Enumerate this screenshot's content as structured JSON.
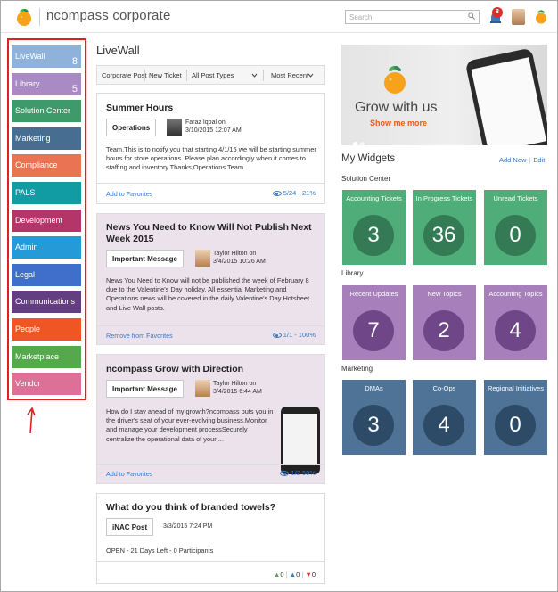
{
  "header": {
    "brand": "ncompass corporate",
    "search_placeholder": "Search",
    "notification_count": "8"
  },
  "sidebar": {
    "items": [
      {
        "label": "LiveWall",
        "count": "8",
        "color": "#8fb2db"
      },
      {
        "label": "Library",
        "count": "5",
        "color": "#a98ac5"
      },
      {
        "label": "Solution Center",
        "count": "",
        "color": "#3f9a6b"
      },
      {
        "label": "Marketing",
        "count": "",
        "color": "#476d90"
      },
      {
        "label": "Compliance",
        "count": "",
        "color": "#ea7353"
      },
      {
        "label": "PALS",
        "count": "",
        "color": "#119ba3"
      },
      {
        "label": "Development",
        "count": "",
        "color": "#b3356a"
      },
      {
        "label": "Admin",
        "count": "",
        "color": "#259ad8"
      },
      {
        "label": "Legal",
        "count": "",
        "color": "#3f6fcb"
      },
      {
        "label": "Communications",
        "count": "",
        "color": "#633f82"
      },
      {
        "label": "People",
        "count": "",
        "color": "#f05623"
      },
      {
        "label": "Marketplace",
        "count": "",
        "color": "#55a84b"
      },
      {
        "label": "Vendor",
        "count": "",
        "color": "#dd7096"
      }
    ]
  },
  "livewall": {
    "title": "LiveWall",
    "filters": {
      "corporate_post": "Corporate Post",
      "new_ticket": "New Ticket",
      "post_types": "All Post Types",
      "sort": "Most Recent"
    },
    "posts": [
      {
        "title": "Summer Hours",
        "tag": "Operations",
        "author": "Faraz Iqbal on",
        "date": "3/10/2015 12:07 AM",
        "body": "Team,This is to notify you that starting 4/1/15 we will be starting summer hours for store operations. Please plan accordingly when it comes to staffing and inventory.Thanks,Operations Team",
        "fav_label": "Add to Favorites",
        "views": "5/24 - 21%"
      },
      {
        "title": "News You Need to Know Will Not Publish Next Week 2015",
        "tag": "Important Message",
        "author": "Taylor Hilton on",
        "date": "3/4/2015 10:26 AM",
        "body": "News You Need to Know will not be published the week of February 8 due to the Valentine's Day holiday. All essential Marketing and Operations news will be covered in the daily Valentine's Day Hotsheet and Live Wall posts.",
        "fav_label": "Remove from Favorites",
        "views": "1/1 - 100%"
      },
      {
        "title": "ncompass Grow with Direction",
        "tag": "Important Message",
        "author": "Taylor Hilton on",
        "date": "3/4/2015 6:44 AM",
        "body": "How do I stay ahead of my growth?ncompass puts you in the driver's seat of your ever-evolving business.Monitor and manage your development processSecurely centralize the operational data of your ...",
        "fav_label": "Add to Favorites",
        "views": "1/2 50%"
      },
      {
        "title": "What do you think of branded towels?",
        "tag": "iNAC Post",
        "date": "3/3/2015 7:24 PM",
        "status": "OPEN - 21 Days Left - 0 Participants",
        "likes": "0",
        "neutral": "0",
        "dislikes": "0"
      }
    ]
  },
  "banner": {
    "headline": "Grow with us",
    "cta": "Show me more"
  },
  "widgets": {
    "title": "My Widgets",
    "add_new": "Add New",
    "edit": "Edit",
    "sections": [
      {
        "name": "Solution Center",
        "tiles": [
          {
            "label": "Accounting Tickets",
            "value": "3"
          },
          {
            "label": "In Progress Tickets",
            "value": "36"
          },
          {
            "label": "Unread Tickets",
            "value": "0"
          }
        ]
      },
      {
        "name": "Library",
        "tiles": [
          {
            "label": "Recent Updates",
            "value": "7"
          },
          {
            "label": "New Topics",
            "value": "2"
          },
          {
            "label": "Accounting Topics",
            "value": "4"
          }
        ]
      },
      {
        "name": "Marketing",
        "tiles": [
          {
            "label": "DMAs",
            "value": "3"
          },
          {
            "label": "Co-Ops",
            "value": "4"
          },
          {
            "label": "Regional Initiatives",
            "value": "0"
          }
        ]
      }
    ]
  }
}
